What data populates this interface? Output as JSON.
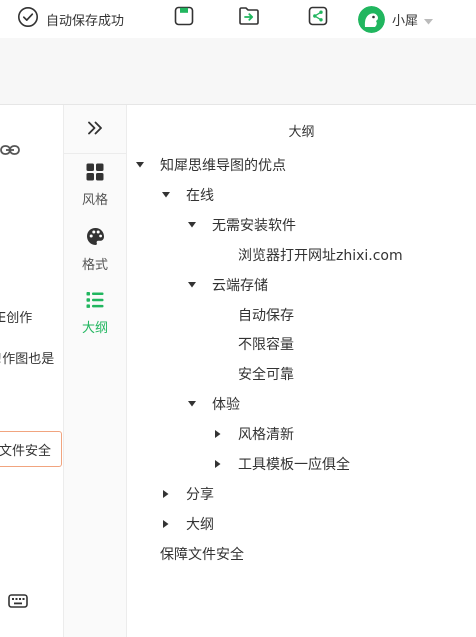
{
  "topbar": {
    "save_status": "自动保存成功",
    "user_name": "小犀"
  },
  "icons": {
    "save_status": "check-circle-icon",
    "save": "save-icon",
    "export": "export-icon",
    "share": "share-icon",
    "avatar": "user-avatar",
    "dropdown": "caret-down-icon",
    "collapse": "double-chevron-right-icon",
    "link": "link-icon",
    "keyboard": "keyboard-icon"
  },
  "colors": {
    "accent": "#21b65f",
    "selection_border": "#f1a47f",
    "toolbar_bg": "#f7f7f7"
  },
  "canvas": {
    "node_create": "E创作",
    "node_map": "!作图也是",
    "node_selected": "文件安全"
  },
  "side_tabs": [
    {
      "label": "风格",
      "icon": "grid-icon",
      "active": false
    },
    {
      "label": "格式",
      "icon": "palette-icon",
      "active": false
    },
    {
      "label": "大纲",
      "icon": "outline-list-icon",
      "active": true
    }
  ],
  "outline": {
    "title": "大纲",
    "items": [
      {
        "text": "知犀思维导图的优点",
        "level": 0,
        "state": "expanded"
      },
      {
        "text": "在线",
        "level": 1,
        "state": "expanded"
      },
      {
        "text": "无需安装软件",
        "level": 2,
        "state": "expanded"
      },
      {
        "text": "浏览器打开网址zhixi.com",
        "level": 3,
        "state": "leaf"
      },
      {
        "text": "云端存储",
        "level": 2,
        "state": "expanded"
      },
      {
        "text": "自动保存",
        "level": 3,
        "state": "leaf"
      },
      {
        "text": "不限容量",
        "level": 3,
        "state": "leaf"
      },
      {
        "text": "安全可靠",
        "level": 3,
        "state": "leaf"
      },
      {
        "text": "体验",
        "level": 2,
        "state": "expanded"
      },
      {
        "text": "风格清新",
        "level": 3,
        "state": "collapsed"
      },
      {
        "text": "工具模板一应俱全",
        "level": 3,
        "state": "collapsed"
      },
      {
        "text": "分享",
        "level": 1,
        "state": "collapsed"
      },
      {
        "text": "大纲",
        "level": 1,
        "state": "collapsed"
      },
      {
        "text": "保障文件安全",
        "level": 0,
        "state": "leaf"
      }
    ]
  }
}
